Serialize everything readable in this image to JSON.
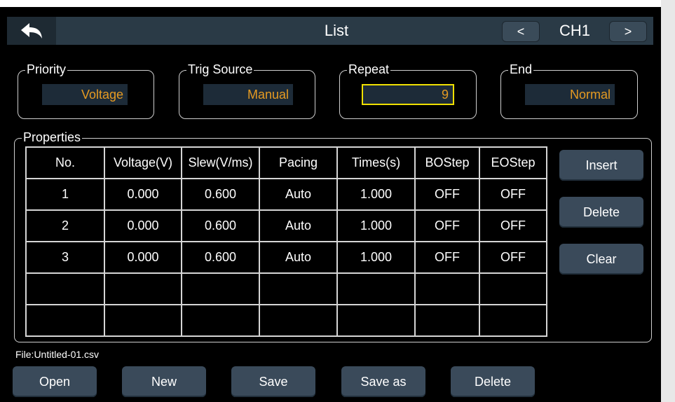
{
  "header": {
    "title": "List",
    "prev_label": "<",
    "next_label": ">",
    "channel": "CH1"
  },
  "params": {
    "priority": {
      "label": "Priority",
      "value": "Voltage"
    },
    "trig_source": {
      "label": "Trig Source",
      "value": "Manual"
    },
    "repeat": {
      "label": "Repeat",
      "value": "9"
    },
    "end": {
      "label": "End",
      "value": "Normal"
    }
  },
  "properties": {
    "label": "Properties",
    "columns": [
      "No.",
      "Voltage(V)",
      "Slew(V/ms)",
      "Pacing",
      "Times(s)",
      "BOStep",
      "EOStep"
    ],
    "rows": [
      [
        "1",
        "0.000",
        "0.600",
        "Auto",
        "1.000",
        "OFF",
        "OFF"
      ],
      [
        "2",
        "0.000",
        "0.600",
        "Auto",
        "1.000",
        "OFF",
        "OFF"
      ],
      [
        "3",
        "0.000",
        "0.600",
        "Auto",
        "1.000",
        "OFF",
        "OFF"
      ],
      [
        "",
        "",
        "",
        "",
        "",
        "",
        ""
      ],
      [
        "",
        "",
        "",
        "",
        "",
        "",
        ""
      ]
    ],
    "actions": {
      "insert": "Insert",
      "delete": "Delete",
      "clear": "Clear"
    }
  },
  "file": {
    "name": "File:Untitled-01.csv"
  },
  "footer": {
    "open": "Open",
    "new": "New",
    "save": "Save",
    "save_as": "Save as",
    "delete": "Delete"
  },
  "colors": {
    "value_text": "#e59a22",
    "focus_border": "#f0e000",
    "button_bg": "#3a4a5a",
    "titlebar_bg": "#2a3a46"
  }
}
